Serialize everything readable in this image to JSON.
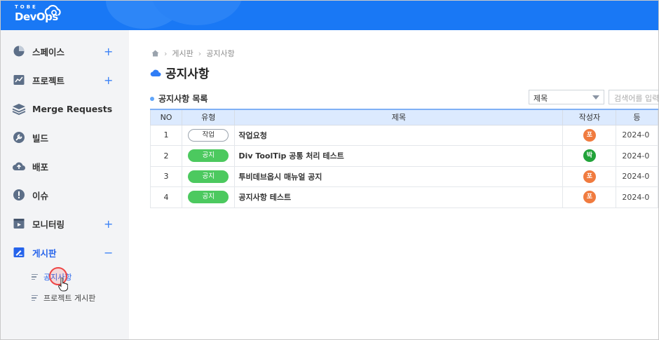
{
  "header": {
    "logo_top": "TOBE",
    "logo_main": "DevOps",
    "brand_color": "#1978f5"
  },
  "sidebar": {
    "items": [
      {
        "label": "스페이스",
        "icon": "pie-chart-icon",
        "plus": "+"
      },
      {
        "label": "프로젝트",
        "icon": "chart-board-icon",
        "plus": "+"
      },
      {
        "label": "Merge Requests",
        "icon": "layers-icon",
        "plus": ""
      },
      {
        "label": "빌드",
        "icon": "wrench-icon",
        "plus": ""
      },
      {
        "label": "배포",
        "icon": "cloud-upload-icon",
        "plus": ""
      },
      {
        "label": "이슈",
        "icon": "alert-circle-icon",
        "plus": ""
      },
      {
        "label": "모니터링",
        "icon": "monitor-icon",
        "plus": "+"
      },
      {
        "label": "게시판",
        "icon": "board-edit-icon",
        "plus": "−"
      }
    ],
    "sub_items": [
      {
        "label": "공지사항"
      },
      {
        "label": "프로젝트 게시판"
      }
    ]
  },
  "breadcrumb": {
    "items": [
      "게시판",
      "공지사항"
    ]
  },
  "page": {
    "title": "공지사항",
    "list_title": "공지사항 목록",
    "filter_selected": "제목",
    "search_placeholder": "검색어를 입력"
  },
  "table": {
    "columns": [
      "NO",
      "유형",
      "제목",
      "작성자",
      "등"
    ],
    "rows": [
      {
        "no": "1",
        "type": "작업",
        "type_style": "task",
        "title": "작업요청",
        "author": "포",
        "author_color": "#f07b3f",
        "date": "2024-0"
      },
      {
        "no": "2",
        "type": "공지",
        "type_style": "notice",
        "title": "Div ToolTip 공통 처리 테스트",
        "author": "박",
        "author_color": "#22a33a",
        "date": "2024-0"
      },
      {
        "no": "3",
        "type": "공지",
        "type_style": "notice",
        "title": "투비데브옵시 매뉴얼 공지",
        "author": "포",
        "author_color": "#f07b3f",
        "date": "2024-0"
      },
      {
        "no": "4",
        "type": "공지",
        "type_style": "notice",
        "title": "공지사항 테스트",
        "author": "포",
        "author_color": "#f07b3f",
        "date": "2024-0"
      }
    ]
  }
}
